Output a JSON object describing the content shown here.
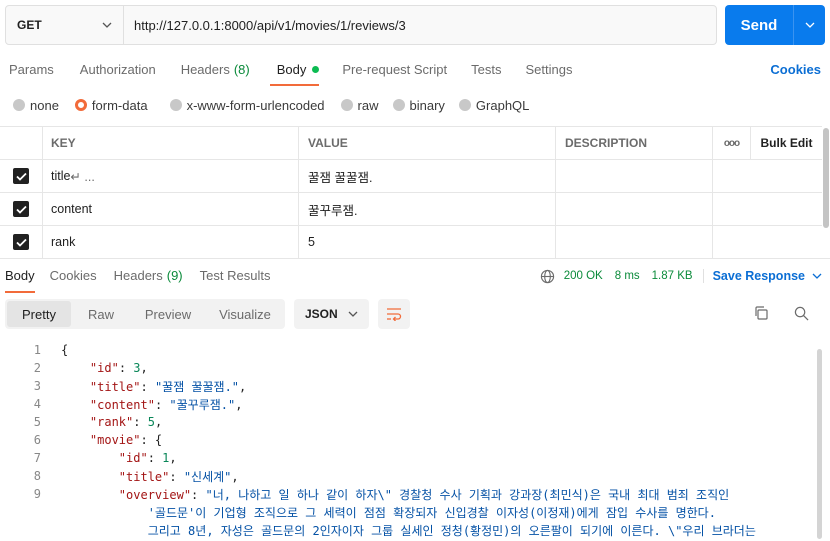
{
  "request": {
    "method": "GET",
    "url": "http://127.0.0.1:8000/api/v1/movies/1/reviews/3",
    "send_label": "Send"
  },
  "req_tabs": {
    "params": "Params",
    "authorization": "Authorization",
    "headers": "Headers",
    "headers_count": "(8)",
    "body": "Body",
    "pre_request": "Pre-request Script",
    "tests": "Tests",
    "settings": "Settings",
    "cookies": "Cookies"
  },
  "body_types": {
    "none": "none",
    "form_data": "form-data",
    "urlencoded": "x-www-form-urlencoded",
    "raw": "raw",
    "binary": "binary",
    "graphql": "GraphQL",
    "selected": "form-data"
  },
  "params_table": {
    "headers": {
      "key": "KEY",
      "value": "VALUE",
      "description": "DESCRIPTION",
      "more": "ooo",
      "bulk_edit": "Bulk Edit"
    },
    "rows": [
      {
        "key": "title",
        "key_suffix": " ↵ ...",
        "value": "꿀잼 꿀꿀잼.",
        "checked": true
      },
      {
        "key": "content",
        "key_suffix": "",
        "value": "꿀꾸루잼.",
        "checked": true
      },
      {
        "key": "rank",
        "key_suffix": "",
        "value": "5",
        "checked": true
      }
    ]
  },
  "response": {
    "tabs": {
      "body": "Body",
      "cookies": "Cookies",
      "headers": "Headers",
      "headers_count": "(9)",
      "test_results": "Test Results"
    },
    "status": "200 OK",
    "time": "8 ms",
    "size": "1.87 KB",
    "save": "Save Response"
  },
  "view": {
    "pretty": "Pretty",
    "raw": "Raw",
    "preview": "Preview",
    "visualize": "Visualize",
    "format": "JSON"
  },
  "code_lines": {
    "n1": "1",
    "n2": "2",
    "n3": "3",
    "n4": "4",
    "n5": "5",
    "n6": "6",
    "n7": "7",
    "n8": "8",
    "n9": "9",
    "brace_open": "{",
    "id_key": "\"id\"",
    "id_val": "3",
    "title_key": "\"title\"",
    "title_val": "\"꿀잼 꿀꿀잼.\"",
    "content_key": "\"content\"",
    "content_val": "\"꿀꾸루잼.\"",
    "rank_key": "\"rank\"",
    "rank_val": "5",
    "movie_key": "\"movie\"",
    "movie_id_key": "\"id\"",
    "movie_id_val": "1",
    "movie_title_key": "\"title\"",
    "movie_title_val": "\"신세계\"",
    "overview_key": "\"overview\"",
    "overview_line1": "\"너, 나하고 일 하나 같이 하자\\\" 경찰청 수사 기획과 강과장(최민식)은 국내 최대 범죄 조직인",
    "overview_line2": "'골드문'이 기업형 조직으로 그 세력이 점점 확장되자 신입경찰 이자성(이정재)에게 잠입 수사를 명한다.",
    "overview_line3": "그리고 8년, 자성은 골드문의 2인자이자 그룹 실세인 정청(황정민)의 오른팔이 되기에 이른다. \\\"우리 브라더는"
  },
  "colors": {
    "accent": "#f26b3a",
    "send": "#097bed",
    "link": "#0b6ed4",
    "ok": "#0a8a3a"
  }
}
